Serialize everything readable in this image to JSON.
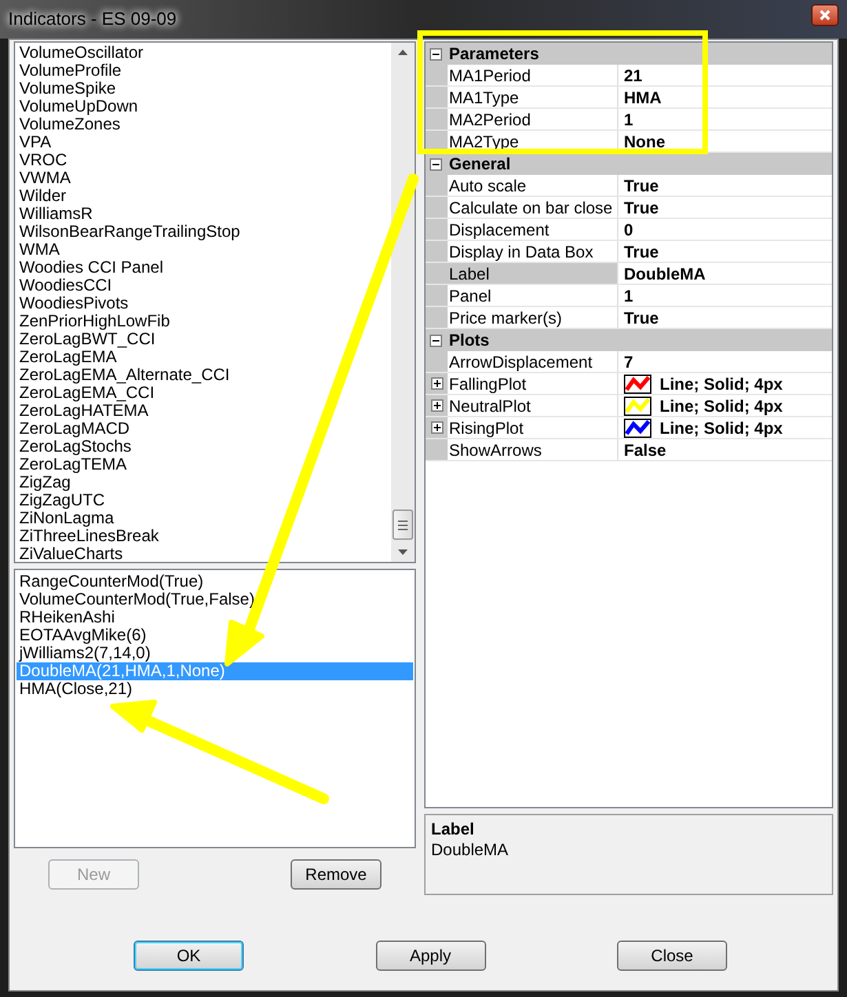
{
  "window": {
    "title": "Indicators - ES 09-09"
  },
  "indicator_list": {
    "items": [
      "VolumeOscillator",
      "VolumeProfile",
      "VolumeSpike",
      "VolumeUpDown",
      "VolumeZones",
      "VPA",
      "VROC",
      "VWMA",
      "Wilder",
      "WilliamsR",
      "WilsonBearRangeTrailingStop",
      "WMA",
      "Woodies CCI Panel",
      "WoodiesCCI",
      "WoodiesPivots",
      "ZenPriorHighLowFib",
      "ZeroLagBWT_CCI",
      "ZeroLagEMA",
      "ZeroLagEMA_Alternate_CCI",
      "ZeroLagEMA_CCI",
      "ZeroLagHATEMA",
      "ZeroLagMACD",
      "ZeroLagStochs",
      "ZeroLagTEMA",
      "ZigZag",
      "ZigZagUTC",
      "ZiNonLagma",
      "ZiThreeLinesBreak",
      "ZiValueCharts"
    ]
  },
  "applied_list": {
    "items": [
      {
        "label": "RangeCounterMod(True)",
        "selected": false
      },
      {
        "label": "VolumeCounterMod(True,False)",
        "selected": false
      },
      {
        "label": "RHeikenAshi",
        "selected": false
      },
      {
        "label": "EOTAAvgMike(6)",
        "selected": false
      },
      {
        "label": "jWilliams2(7,14,0)",
        "selected": false
      },
      {
        "label": "DoubleMA(21,HMA,1,None)",
        "selected": true
      },
      {
        "label": "HMA(Close,21)",
        "selected": false
      }
    ]
  },
  "list_buttons": [
    {
      "label": "New",
      "disabled": true
    },
    {
      "label": "Remove",
      "disabled": false
    }
  ],
  "properties": {
    "categories": [
      {
        "name": "Parameters",
        "expanded": true,
        "rows": [
          {
            "kind": "value",
            "name": "MA1Period",
            "value": "21",
            "selected": false
          },
          {
            "kind": "value",
            "name": "MA1Type",
            "value": "HMA",
            "selected": false
          },
          {
            "kind": "value",
            "name": "MA2Period",
            "value": "1",
            "selected": false
          },
          {
            "kind": "value",
            "name": "MA2Type",
            "value": "None",
            "selected": false
          }
        ]
      },
      {
        "name": "General",
        "expanded": true,
        "rows": [
          {
            "kind": "value",
            "name": "Auto scale",
            "value": "True",
            "selected": false
          },
          {
            "kind": "value",
            "name": "Calculate on bar close",
            "value": "True",
            "selected": false
          },
          {
            "kind": "value",
            "name": "Displacement",
            "value": "0",
            "selected": false
          },
          {
            "kind": "value",
            "name": "Display in Data Box",
            "value": "True",
            "selected": false
          },
          {
            "kind": "value",
            "name": "Label",
            "value": "DoubleMA",
            "selected": true
          },
          {
            "kind": "value",
            "name": "Panel",
            "value": "1",
            "selected": false
          },
          {
            "kind": "value",
            "name": "Price marker(s)",
            "value": "True",
            "selected": false
          }
        ]
      },
      {
        "name": "Plots",
        "expanded": true,
        "rows": [
          {
            "kind": "value",
            "name": "ArrowDisplacement",
            "value": "7",
            "selected": false
          },
          {
            "kind": "plot",
            "name": "FallingPlot",
            "value": "Line; Solid; 4px",
            "color": "#ff0000",
            "expanded": false,
            "selected": false
          },
          {
            "kind": "plot",
            "name": "NeutralPlot",
            "value": "Line; Solid; 4px",
            "color": "#ffff00",
            "expanded": false,
            "selected": false
          },
          {
            "kind": "plot",
            "name": "RisingPlot",
            "value": "Line; Solid; 4px",
            "color": "#0000ff",
            "expanded": false,
            "selected": false
          },
          {
            "kind": "value",
            "name": "ShowArrows",
            "value": "False",
            "selected": false
          }
        ]
      }
    ]
  },
  "description": {
    "title": "Label",
    "text": "DoubleMA"
  },
  "dialog_buttons": [
    {
      "label": "OK",
      "default": true
    },
    {
      "label": "Apply",
      "default": false
    },
    {
      "label": "Close",
      "default": false
    }
  ]
}
